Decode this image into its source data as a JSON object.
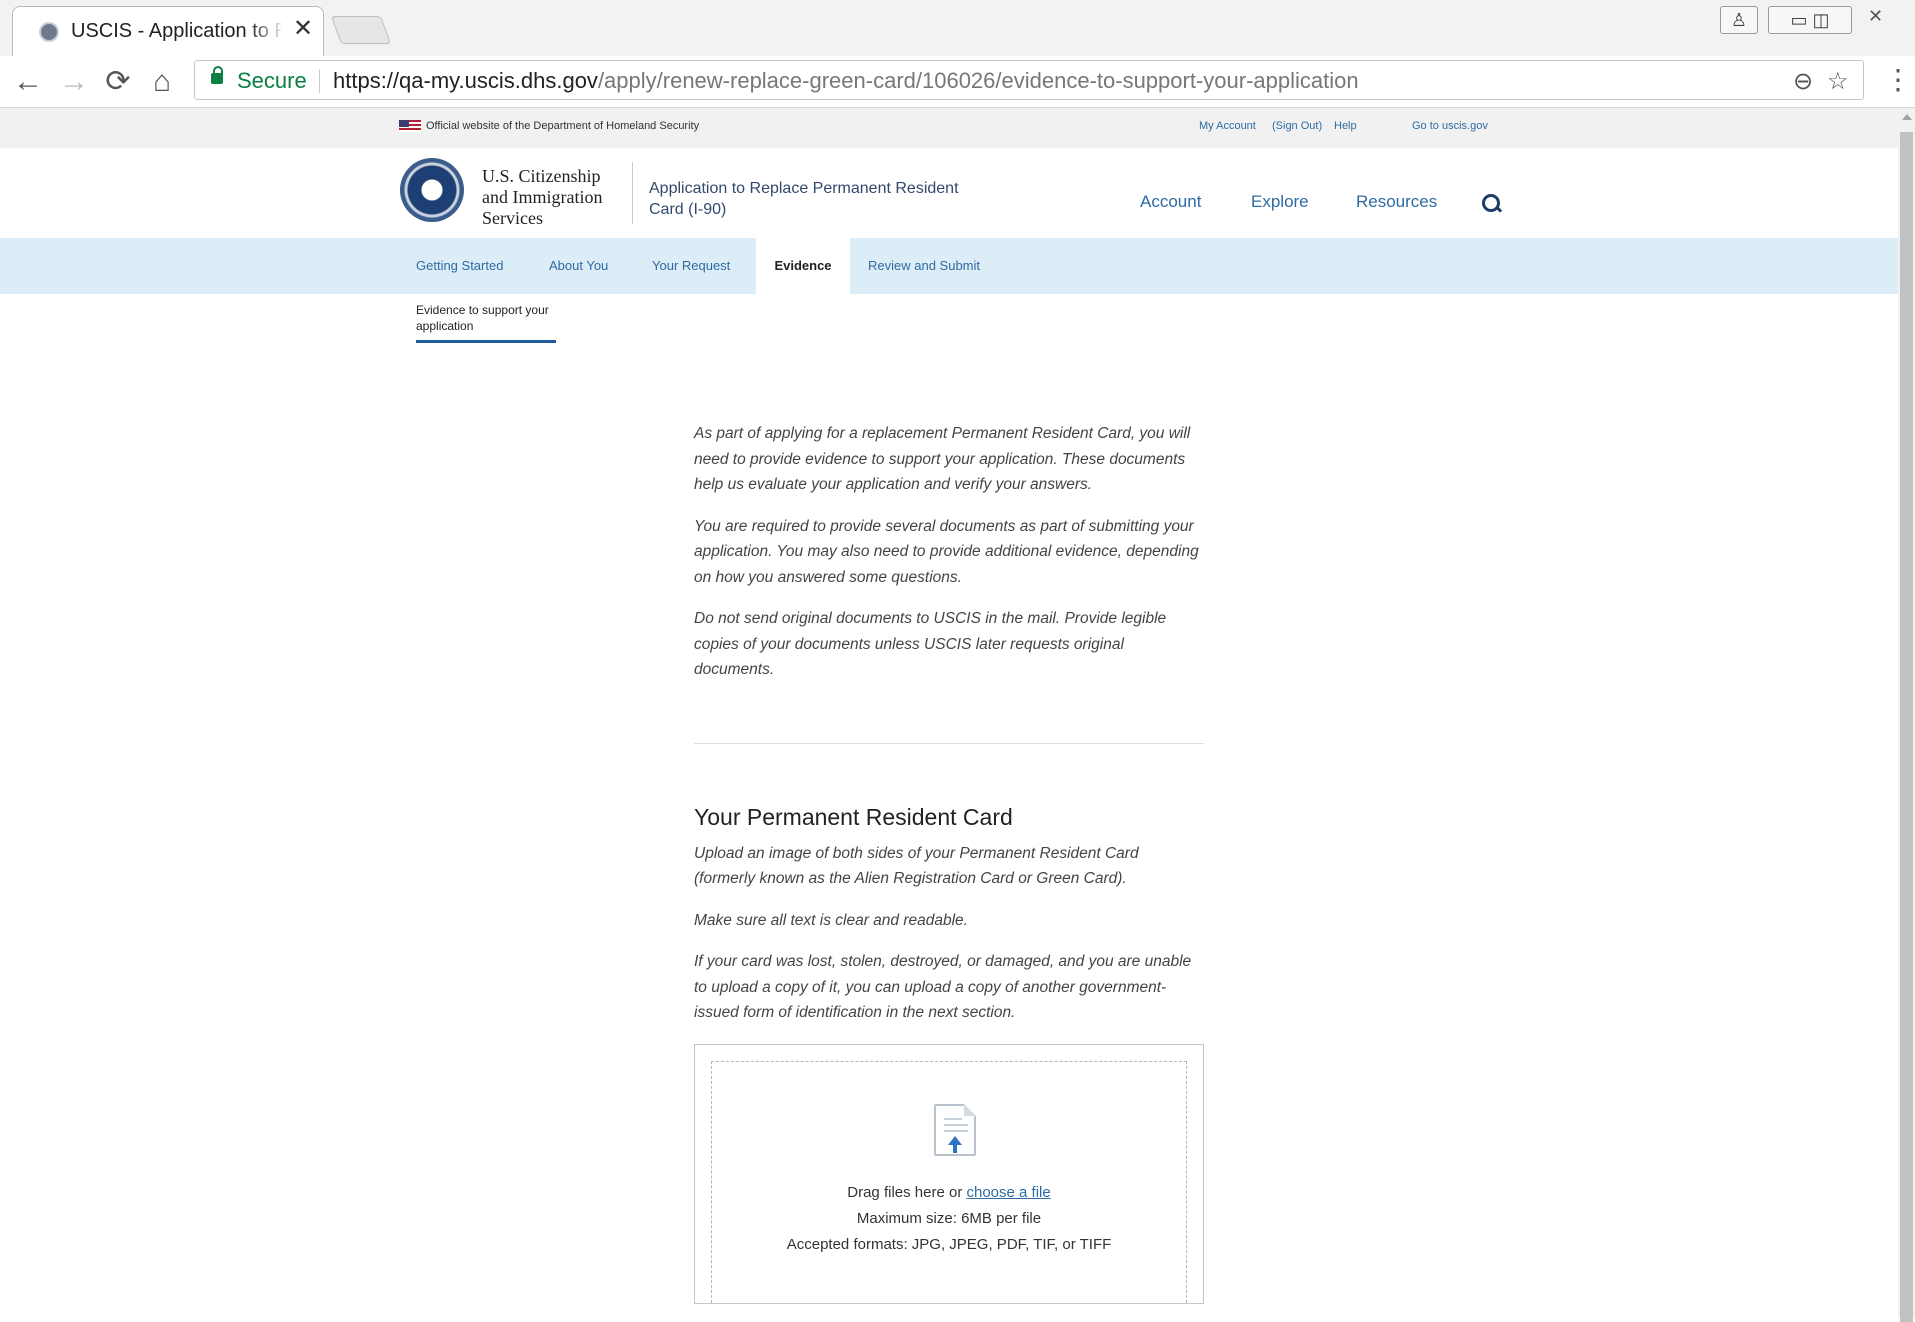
{
  "browser": {
    "tab_title": "USCIS - Application to Replace Permanent Resident Card",
    "tab_close": "✕",
    "secure_label": "Secure",
    "url_host": "https://qa-my.uscis.dhs.gov",
    "url_path": "/apply/renew-replace-green-card/106026/evidence-to-support-your-application",
    "back_icon": "←",
    "forward_icon": "→",
    "reload_icon": "⟳",
    "home_icon": "⌂",
    "zoom_icon": "⊖",
    "star_icon": "☆",
    "menu_icon": "⋮"
  },
  "gov_banner": {
    "official_text": "Official website of the Department of Homeland Security",
    "my_account": "My Account",
    "sign_out": "(Sign Out)",
    "help": "Help",
    "go_to": "Go to uscis.gov"
  },
  "header": {
    "agency_line1": "U.S. Citizenship",
    "agency_line2": "and Immigration",
    "agency_line3": "Services",
    "app_title": "Application to Replace Permanent Resident Card (I-90)",
    "nav": [
      "Account",
      "Explore",
      "Resources"
    ]
  },
  "steps": {
    "tabs": [
      "Getting Started",
      "About You",
      "Your Request",
      "Evidence",
      "Review and Submit"
    ],
    "active": "Evidence",
    "sub_item": "Evidence to support your application"
  },
  "intro": {
    "p1": "As part of applying for a replacement Permanent Resident Card, you will need to provide evidence to support your application. These documents help us evaluate your application and verify your answers.",
    "p2": "You are required to provide several documents as part of submitting your application. You may also need to provide additional evidence, depending on how you answered some questions.",
    "p3": "Do not send original documents to USCIS in the mail. Provide legible copies of your documents unless USCIS later requests original documents."
  },
  "card_section": {
    "title": "Your Permanent Resident Card",
    "p1": "Upload an image of both sides of your Permanent Resident Card (formerly known as the Alien Registration Card or Green Card).",
    "p2": "Make sure all text is clear and readable.",
    "p3": "If your card was lost, stolen, destroyed, or damaged, and you are unable to upload a copy of it, you can upload a copy of another government-issued form of identification in the next section."
  },
  "upload": {
    "drag_text": "Drag files here or ",
    "choose_link": "choose a file",
    "max_size": "Maximum size: 6MB per file",
    "formats": "Accepted formats: JPG, JPEG, PDF, TIF, or TIFF",
    "icon": "file-upload-icon"
  },
  "colors": {
    "step_nav_bg": "#dcedf8",
    "link": "#2e6ba3",
    "secure_green": "#0b8043"
  }
}
